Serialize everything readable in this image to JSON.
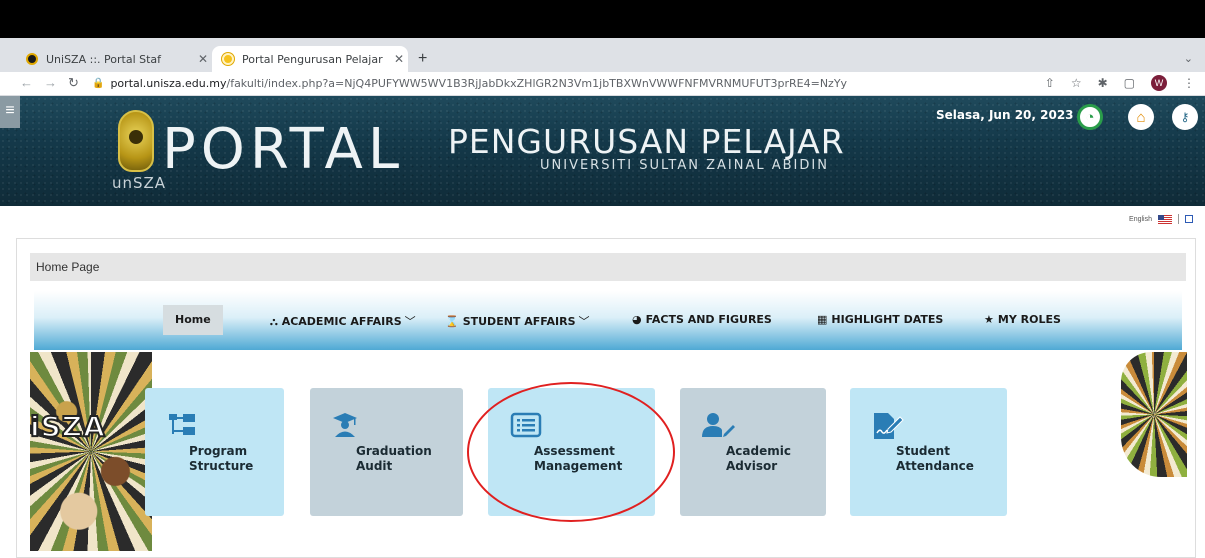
{
  "browser": {
    "tabs": [
      {
        "title": "UniSZA ::. Portal Staf",
        "active": false
      },
      {
        "title": "Portal Pengurusan Pelajar",
        "active": true
      }
    ],
    "new_tab_label": "+",
    "close_glyph": "✕",
    "url_domain": "portal.unisza.edu.my",
    "url_path": "/fakulti/index.php?a=NjQ4PUFYWW5WV1B3RjJabDkxZHlGR2N3Vm1jbTBXWnVWWFNFMVRNMUFUT3prRE4=NzYy",
    "profile_initial": "W"
  },
  "banner": {
    "logo_text": "unSZA",
    "portal_word": "PORTAL",
    "pengurusan_word": "PENGURUSAN  PELAJAR",
    "university_name": "UNIVERSITI  SULTAN  ZAINAL  ABIDIN",
    "date": "Selasa, Jun 20, 2023"
  },
  "language": {
    "label": "English"
  },
  "breadcrumb": {
    "label": "Home Page"
  },
  "nav": {
    "home": "Home",
    "academic_affairs": "ACADEMIC AFFAIRS",
    "student_affairs": "STUDENT AFFAIRS",
    "facts_and_figures": "FACTS AND FIGURES",
    "highlight_dates": "HIGHLIGHT DATES",
    "my_roles": "MY ROLES"
  },
  "decor": {
    "left_word": "iSZA"
  },
  "tiles": [
    {
      "line1": "Program",
      "line2": "Structure",
      "icon": "sitemap-icon"
    },
    {
      "line1": "Graduation",
      "line2": "Audit",
      "icon": "graduate-icon"
    },
    {
      "line1": "Assessment",
      "line2": "Management",
      "icon": "list-alt-icon"
    },
    {
      "line1": "Academic",
      "line2": "Advisor",
      "icon": "user-edit-icon"
    },
    {
      "line1": "Student",
      "line2": "Attendance",
      "icon": "file-signature-icon"
    }
  ],
  "colors": {
    "tile_blue": "#bfe6f5",
    "tile_grey": "#c3d2da",
    "nav_gradient_bottom": "#4fa9d4",
    "highlight_oval": "#e02020",
    "icon_blue": "#2a7db5"
  }
}
